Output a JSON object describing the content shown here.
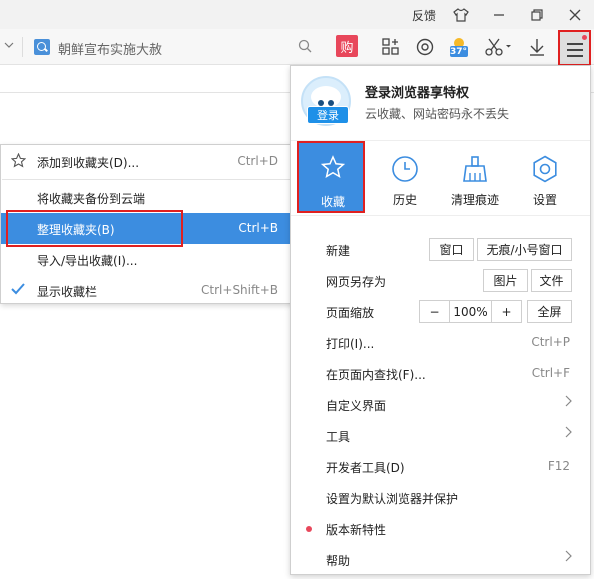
{
  "titlebar": {
    "feedback": "反馈",
    "buttons": [
      "shirt",
      "minimize",
      "restore",
      "close"
    ]
  },
  "toolbar": {
    "address_text": "朝鲜宣布实施大赦",
    "gou_label": "购",
    "weather_temp": "37°"
  },
  "fav_submenu": {
    "items": [
      {
        "label": "添加到收藏夹(D)...",
        "shortcut": "Ctrl+D"
      },
      {
        "label": "将收藏夹备份到云端",
        "shortcut": ""
      },
      {
        "label": "整理收藏夹(B)",
        "shortcut": "Ctrl+B"
      },
      {
        "label": "导入/导出收藏(I)...",
        "shortcut": ""
      },
      {
        "label": "显示收藏栏",
        "shortcut": "Ctrl+Shift+B"
      }
    ]
  },
  "main_menu": {
    "login": {
      "badge": "登录",
      "title": "登录浏览器享特权",
      "subtitle": "云收藏、网站密码永不丢失"
    },
    "quick": [
      {
        "label": "收藏",
        "icon": "star-icon"
      },
      {
        "label": "历史",
        "icon": "clock-icon"
      },
      {
        "label": "清理痕迹",
        "icon": "broom-icon"
      },
      {
        "label": "设置",
        "icon": "gear-icon"
      }
    ],
    "new": {
      "label": "新建",
      "window": "窗口",
      "private_window": "无痕/小号窗口"
    },
    "save_as": {
      "label": "网页另存为",
      "image": "图片",
      "file": "文件"
    },
    "zoom": {
      "label": "页面缩放",
      "minus": "−",
      "value": "100%",
      "plus": "+",
      "fullscreen": "全屏"
    },
    "print": {
      "label": "打印(I)...",
      "shortcut": "Ctrl+P"
    },
    "find": {
      "label": "在页面内查找(F)...",
      "shortcut": "Ctrl+F"
    },
    "customize": {
      "label": "自定义界面"
    },
    "tools": {
      "label": "工具"
    },
    "devtools": {
      "label": "开发者工具(D)",
      "shortcut": "F12"
    },
    "set_default": {
      "label": "设置为默认浏览器并保护"
    },
    "whats_new": {
      "label": "版本新特性"
    },
    "help": {
      "label": "帮助"
    }
  }
}
